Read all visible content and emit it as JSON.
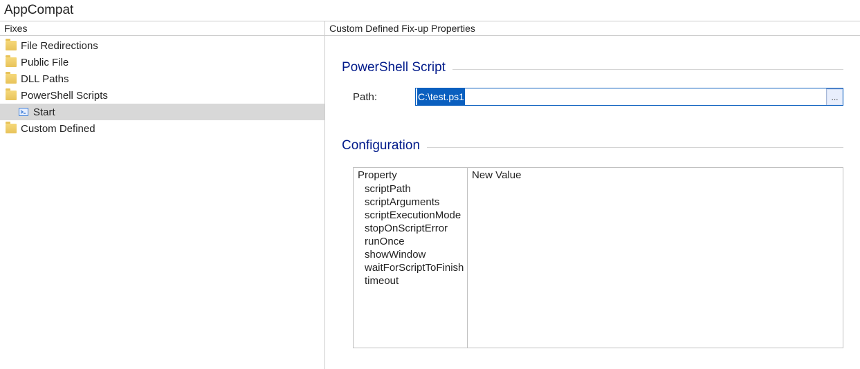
{
  "app": {
    "title": "AppCompat"
  },
  "left": {
    "header": "Fixes",
    "items": [
      {
        "label": "File Redirections",
        "icon": "folder",
        "level": 1,
        "selected": false
      },
      {
        "label": "Public File",
        "icon": "folder",
        "level": 1,
        "selected": false
      },
      {
        "label": "DLL Paths",
        "icon": "folder",
        "level": 1,
        "selected": false
      },
      {
        "label": "PowerShell Scripts",
        "icon": "folder",
        "level": 1,
        "selected": false
      },
      {
        "label": "Start",
        "icon": "script",
        "level": 2,
        "selected": true
      },
      {
        "label": "Custom Defined",
        "icon": "folder",
        "level": 1,
        "selected": false
      }
    ]
  },
  "right": {
    "header": "Custom Defined Fix-up Properties",
    "powershell": {
      "legend": "PowerShell Script",
      "path_label": "Path:",
      "path_value": "C:\\test.ps1",
      "browse_label": "..."
    },
    "configuration": {
      "legend": "Configuration",
      "col_property": "Property",
      "col_newvalue": "New Value",
      "properties": [
        "scriptPath",
        "scriptArguments",
        "scriptExecutionMode",
        "stopOnScriptError",
        "runOnce",
        "showWindow",
        "waitForScriptToFinish",
        "timeout"
      ]
    }
  }
}
